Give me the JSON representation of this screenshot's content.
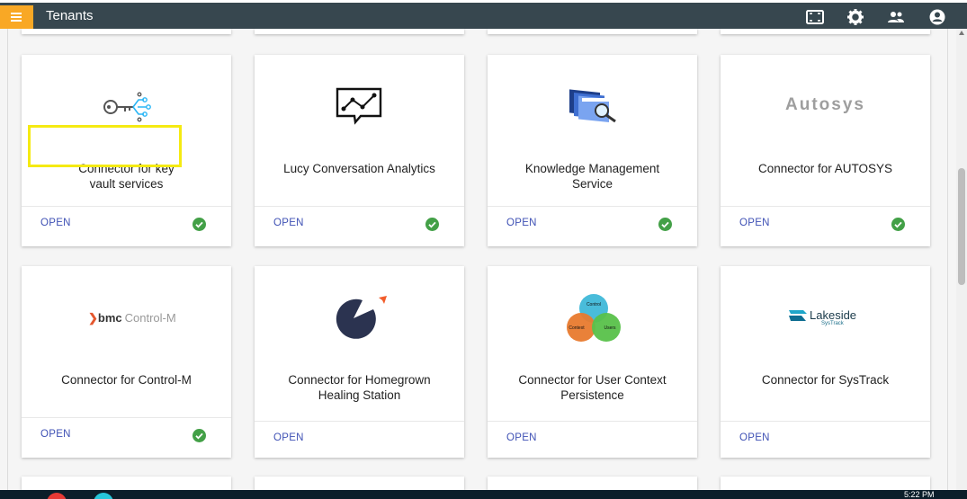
{
  "header": {
    "title": "Tenants",
    "icons": [
      "fullscreen-icon",
      "gear-icon",
      "people-icon",
      "account-circle-icon"
    ]
  },
  "cards": [
    {
      "name": "Connector for key vault services",
      "open": "OPEN",
      "status": "active",
      "logo": "key-network-icon"
    },
    {
      "name": "Lucy Conversation Analytics",
      "open": "OPEN",
      "status": "active",
      "logo": "chat-analytics-icon"
    },
    {
      "name": "Knowledge Management Service",
      "open": "OPEN",
      "status": "active",
      "logo": "folders-search-icon"
    },
    {
      "name": "Connector for AUTOSYS",
      "open": "OPEN",
      "status": "active",
      "logo_text": "Autosys"
    },
    {
      "name": "Connector for Control-M",
      "open": "OPEN",
      "status": "active",
      "logo_text_brand": "bmc",
      "logo_text_product": "Control-M"
    },
    {
      "name": "Connector for Homegrown Healing Station",
      "open": "OPEN",
      "logo": "pie-chart-icon"
    },
    {
      "name": "Connector for User Context Persistence",
      "open": "OPEN",
      "logo_labels": [
        "Control",
        "Context",
        "Users"
      ]
    },
    {
      "name": "Connector for SysTrack",
      "open": "OPEN",
      "logo_text_brand": "Lakeside",
      "logo_text_product": "SysTrack"
    }
  ],
  "taskbar": {
    "time": "5:22 PM"
  },
  "colors": {
    "header": "#37474f",
    "accent": "#f9a825",
    "link": "#3f51b5",
    "success": "#43a047",
    "highlight": "#f5ea12"
  }
}
